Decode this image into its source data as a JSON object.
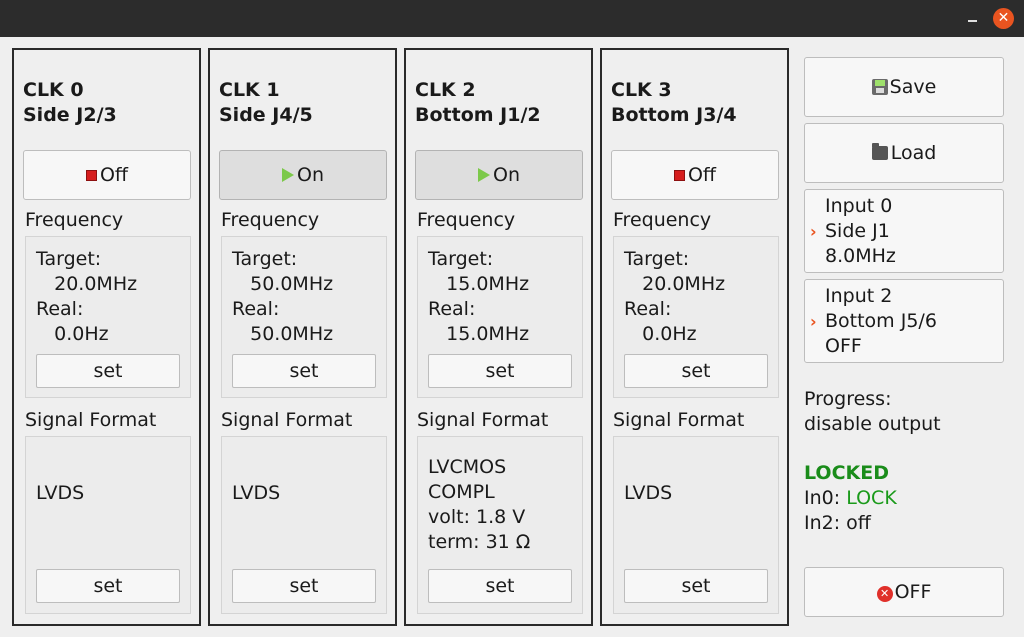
{
  "window": {
    "minimize_icon": "minimize-icon",
    "close_icon": "close-icon",
    "close_glyph": "✕"
  },
  "clocks": [
    {
      "title": "CLK 0\nSide J2/3",
      "state_label": "Off",
      "state": "off",
      "frequency_label": "Frequency",
      "frequency_text": "Target:\n   20.0MHz\nReal:\n   0.0Hz",
      "set_label": "set",
      "signal_label": "Signal Format",
      "signal_text": "LVDS",
      "signal_set_label": "set"
    },
    {
      "title": "CLK 1\nSide J4/5",
      "state_label": "On",
      "state": "on",
      "frequency_label": "Frequency",
      "frequency_text": "Target:\n   50.0MHz\nReal:\n   50.0MHz",
      "set_label": "set",
      "signal_label": "Signal Format",
      "signal_text": "LVDS",
      "signal_set_label": "set"
    },
    {
      "title": "CLK 2\nBottom J1/2",
      "state_label": "On",
      "state": "on",
      "frequency_label": "Frequency",
      "frequency_text": "Target:\n   15.0MHz\nReal:\n   15.0MHz",
      "set_label": "set",
      "signal_label": "Signal Format",
      "signal_text": "LVCMOS\nCOMPL\nvolt: 1.8 V\nterm: 31 Ω",
      "signal_set_label": "set"
    },
    {
      "title": "CLK 3\nBottom J3/4",
      "state_label": "Off",
      "state": "off",
      "frequency_label": "Frequency",
      "frequency_text": "Target:\n   20.0MHz\nReal:\n   0.0Hz",
      "set_label": "set",
      "signal_label": "Signal Format",
      "signal_text": "LVDS",
      "signal_set_label": "set"
    }
  ],
  "side": {
    "save_label": "Save",
    "load_label": "Load",
    "inputs": [
      {
        "text": "Input 0\nSide J1\n8.0MHz"
      },
      {
        "text": "Input 2\nBottom J5/6\nOFF"
      }
    ],
    "progress_text": "Progress:\ndisable output",
    "locked_label": "LOCKED",
    "in0_prefix": "In0: ",
    "in0_value": "LOCK",
    "in2_text": "In2: off",
    "off_label": "OFF",
    "off_glyph": "✕"
  },
  "colors": {
    "accent": "#e95420",
    "lock_green": "#1a9a1a",
    "stop_red": "#d61d1d",
    "play_green": "#7cc94a"
  }
}
